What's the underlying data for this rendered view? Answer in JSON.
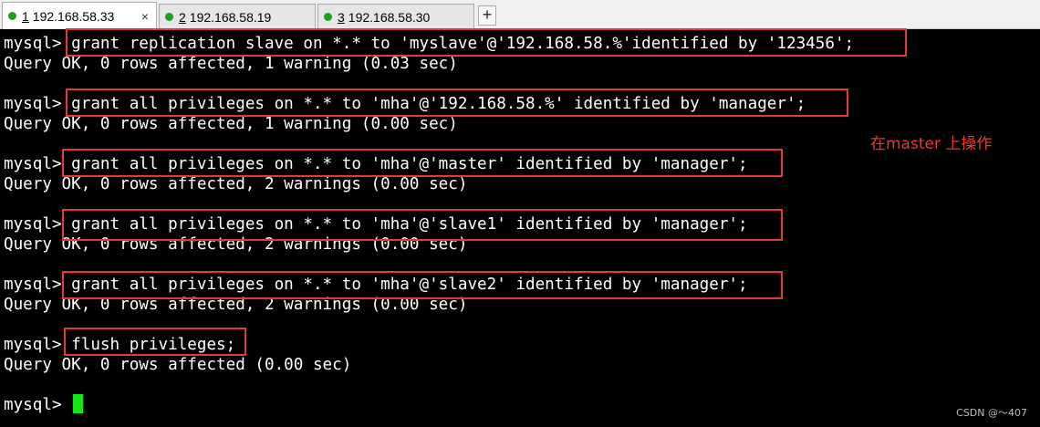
{
  "tabs": [
    {
      "number": "1",
      "title": "192.168.58.33",
      "status_color": "#1aa21a",
      "active": true
    },
    {
      "number": "2",
      "title": "192.168.58.19",
      "status_color": "#1aa21a",
      "active": false
    },
    {
      "number": "3",
      "title": "192.168.58.30",
      "status_color": "#1aa21a",
      "active": false
    }
  ],
  "tab_close_icon": "×",
  "tab_add_icon": "+",
  "terminal": {
    "prompt": "mysql>",
    "lines": [
      {
        "prompt": "mysql>",
        "text": " grant replication slave on *.* to 'myslave'@'192.168.58.%'identified by '123456';"
      },
      {
        "prompt": "",
        "text": "Query OK, 0 rows affected, 1 warning (0.03 sec)"
      },
      {
        "prompt": "mysql>",
        "text": " grant all privileges on *.* to 'mha'@'192.168.58.%' identified by 'manager';"
      },
      {
        "prompt": "",
        "text": "Query OK, 0 rows affected, 1 warning (0.00 sec)"
      },
      {
        "prompt": "mysql>",
        "text": " grant all privileges on *.* to 'mha'@'master' identified by 'manager';"
      },
      {
        "prompt": "",
        "text": "Query OK, 0 rows affected, 2 warnings (0.00 sec)"
      },
      {
        "prompt": "mysql>",
        "text": " grant all privileges on *.* to 'mha'@'slave1' identified by 'manager';"
      },
      {
        "prompt": "",
        "text": "Query OK, 0 rows affected, 2 warnings (0.00 sec)"
      },
      {
        "prompt": "mysql>",
        "text": " grant all privileges on *.* to 'mha'@'slave2' identified by 'manager';"
      },
      {
        "prompt": "",
        "text": "Query OK, 0 rows affected, 2 warnings (0.00 sec)"
      },
      {
        "prompt": "mysql>",
        "text": " flush privileges;"
      },
      {
        "prompt": "",
        "text": "Query OK, 0 rows affected (0.00 sec)"
      },
      {
        "prompt": "mysql>",
        "text": " "
      }
    ]
  },
  "annotation": {
    "text": "在master 上操作",
    "color": "#e53935"
  },
  "highlight_color": "#e53935",
  "cursor_color": "#14e514",
  "watermark": "CSDN @～407"
}
